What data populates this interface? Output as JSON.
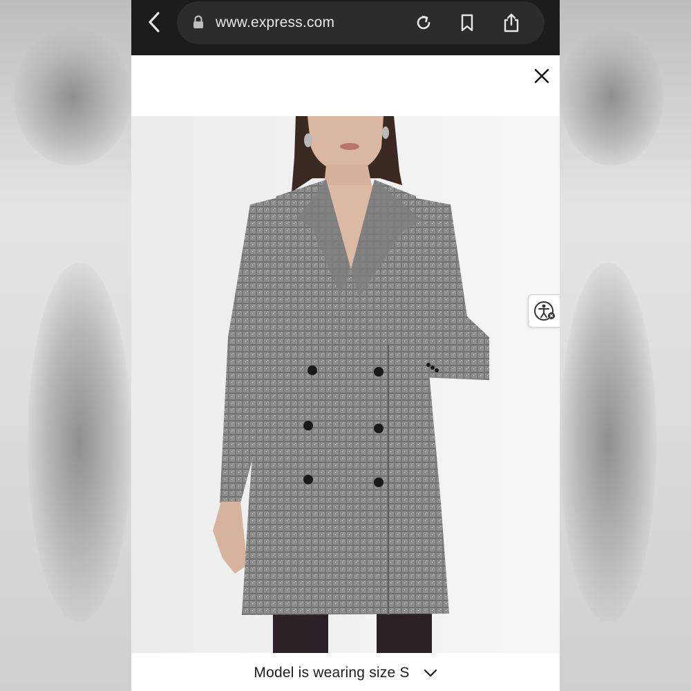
{
  "browser": {
    "url": "www.express.com"
  },
  "product": {
    "size_note": "Model is wearing size S"
  },
  "icons": {
    "back": "chevron-left-icon",
    "lock": "lock-icon",
    "reload": "reload-icon",
    "bookmark": "bookmark-icon",
    "share": "share-icon",
    "close": "close-icon",
    "accessibility": "accessibility-icon",
    "expand": "chevron-down-icon"
  },
  "colors": {
    "browser_bar": "#1c1c1e",
    "url_pill": "#2c2c2e",
    "garment": "#8a8a8a"
  }
}
